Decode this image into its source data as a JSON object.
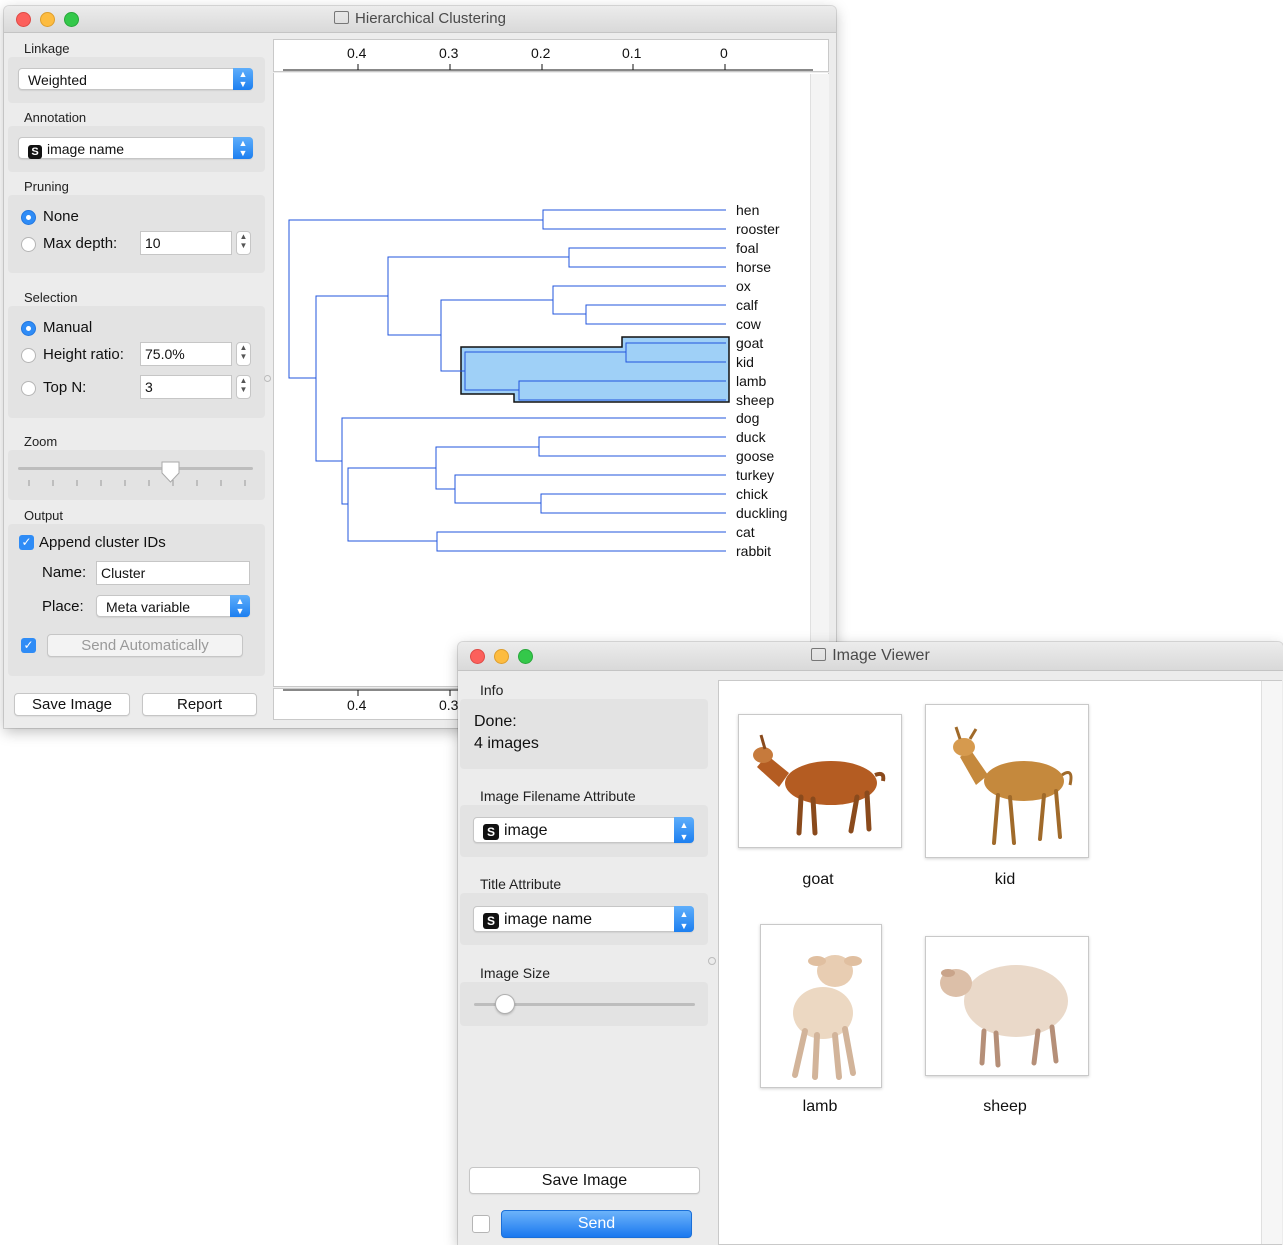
{
  "hc_window": {
    "title": "Hierarchical Clustering",
    "linkage": {
      "label": "Linkage",
      "value": "Weighted"
    },
    "annotation": {
      "label": "Annotation",
      "value": "image name",
      "type_badge": "S"
    },
    "pruning": {
      "label": "Pruning",
      "none_label": "None",
      "max_depth_label": "Max depth:",
      "max_depth_value": "10",
      "selected": "None"
    },
    "selection": {
      "label": "Selection",
      "manual_label": "Manual",
      "height_ratio_label": "Height ratio:",
      "height_ratio_value": "75.0%",
      "top_n_label": "Top N:",
      "top_n_value": "3",
      "selected": "Manual"
    },
    "zoom": {
      "label": "Zoom",
      "level": 0.65
    },
    "output": {
      "label": "Output",
      "append_label": "Append cluster IDs",
      "append_checked": true,
      "name_label": "Name:",
      "name_value": "Cluster",
      "place_label": "Place:",
      "place_value": "Meta variable",
      "auto_checked": true,
      "send_auto_label": "Send Automatically"
    },
    "save_image_label": "Save Image",
    "report_label": "Report",
    "axis_ticks_top": [
      "0.4",
      "0.3",
      "0.2",
      "0.1",
      "0"
    ],
    "axis_ticks_bottom": [
      "0.4",
      "0.3"
    ],
    "leaves": [
      "hen",
      "rooster",
      "foal",
      "horse",
      "ox",
      "calf",
      "cow",
      "goat",
      "kid",
      "lamb",
      "sheep",
      "dog",
      "duck",
      "goose",
      "turkey",
      "chick",
      "duckling",
      "cat",
      "rabbit"
    ],
    "selected_cluster": [
      "goat",
      "kid",
      "lamb",
      "sheep"
    ],
    "colors": {
      "tree": "#2255dd",
      "selection": "#9fd0f7"
    }
  },
  "iv_window": {
    "title": "Image Viewer",
    "info_label": "Info",
    "info_line1": "Done:",
    "info_line2": "4 images",
    "filename_attr_label": "Image Filename Attribute",
    "filename_attr_value": "image",
    "title_attr_label": "Title Attribute",
    "title_attr_value": "image name",
    "type_badge": "S",
    "image_size_label": "Image Size",
    "image_size_level": 0.14,
    "save_image_label": "Save Image",
    "send_label": "Send",
    "send_auto_checked": false,
    "images": [
      {
        "caption": "goat"
      },
      {
        "caption": "kid"
      },
      {
        "caption": "lamb"
      },
      {
        "caption": "sheep"
      }
    ]
  }
}
